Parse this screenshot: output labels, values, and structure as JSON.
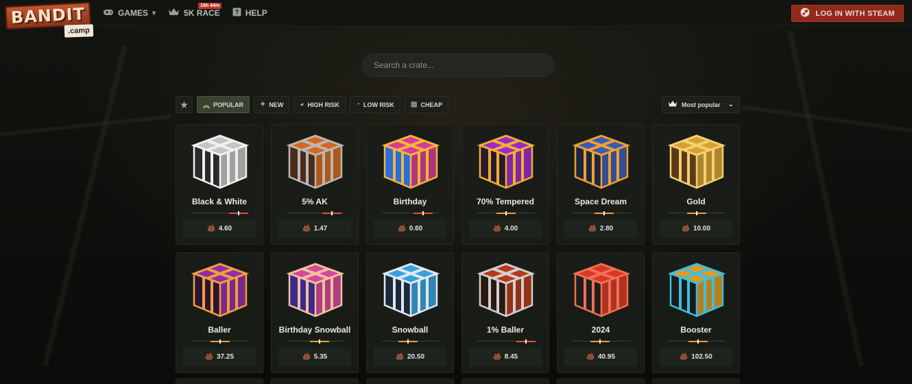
{
  "logo": {
    "main": "BANDIT",
    "sub": ".camp"
  },
  "nav": [
    {
      "label": "GAMES",
      "icon": "gamepad-icon",
      "caret": "▾"
    },
    {
      "label": "5K RACE",
      "icon": "crown-icon",
      "badge": "16h 44m"
    },
    {
      "label": "HELP",
      "icon": "help-icon"
    }
  ],
  "login": {
    "label": "LOG IN WITH STEAM",
    "icon": "steam-icon"
  },
  "search": {
    "placeholder": "Search a crate..."
  },
  "filters": [
    {
      "label": "",
      "icon": "star-icon"
    },
    {
      "label": "POPULAR",
      "icon": "popular-icon",
      "active": true
    },
    {
      "label": "NEW",
      "icon": "sparkle-icon"
    },
    {
      "label": "HIGH RISK",
      "icon": "gauge-high-icon"
    },
    {
      "label": "LOW RISK",
      "icon": "gauge-low-icon"
    },
    {
      "label": "CHEAP",
      "icon": "coins-icon"
    }
  ],
  "sort": {
    "label": "Most popular",
    "icon": "crown-icon"
  },
  "colors": {
    "accent": "#8f2a1d",
    "risk_high": "#e2553c",
    "risk_mid": "#f0a23a"
  },
  "crates": [
    {
      "name": "Black & White",
      "price": "4.60",
      "risk": 0.82,
      "colors": [
        "#cfcfcf",
        "#2a2a2a",
        "#f0f0f0"
      ]
    },
    {
      "name": "5% AK",
      "price": "1.47",
      "risk": 0.78,
      "colors": [
        "#e06c1e",
        "#4a2b1a",
        "#b8b8b8"
      ]
    },
    {
      "name": "Birthday",
      "price": "0.60",
      "risk": 0.72,
      "colors": [
        "#e23ea0",
        "#2a6ee0",
        "#f5b734"
      ]
    },
    {
      "name": "70% Tempered",
      "price": "4.00",
      "risk": 0.5,
      "colors": [
        "#a02ad8",
        "#2a1a2e",
        "#f0b030"
      ]
    },
    {
      "name": "Space Dream",
      "price": "2.80",
      "risk": 0.55,
      "colors": [
        "#3a5fc0",
        "#1c2540",
        "#f0a030"
      ]
    },
    {
      "name": "Gold",
      "price": "10.00",
      "risk": 0.5,
      "colors": [
        "#e0a838",
        "#5a3a1a",
        "#f5d070"
      ]
    },
    {
      "name": "Baller",
      "price": "37.25",
      "risk": 0.5,
      "colors": [
        "#9a2fb0",
        "#2a1430",
        "#f0a040"
      ]
    },
    {
      "name": "Birthday Snowball",
      "price": "5.35",
      "risk": 0.57,
      "colors": [
        "#e04aa0",
        "#3a2a8a",
        "#f0c0a0"
      ]
    },
    {
      "name": "Snowball",
      "price": "20.50",
      "risk": 0.45,
      "colors": [
        "#3aa8e8",
        "#1a2a3a",
        "#e0e8f0"
      ]
    },
    {
      "name": "1% Baller",
      "price": "8.45",
      "risk": 0.85,
      "colors": [
        "#c03a1a",
        "#2a1a14",
        "#d0d0d0"
      ]
    },
    {
      "name": "2024",
      "price": "40.95",
      "risk": 0.48,
      "colors": [
        "#e03a2a",
        "#1e1e1e",
        "#f07050"
      ]
    },
    {
      "name": "Booster",
      "price": "102.50",
      "risk": 0.52,
      "colors": [
        "#f0a020",
        "#1a1a1a",
        "#3ac0e0"
      ]
    }
  ]
}
